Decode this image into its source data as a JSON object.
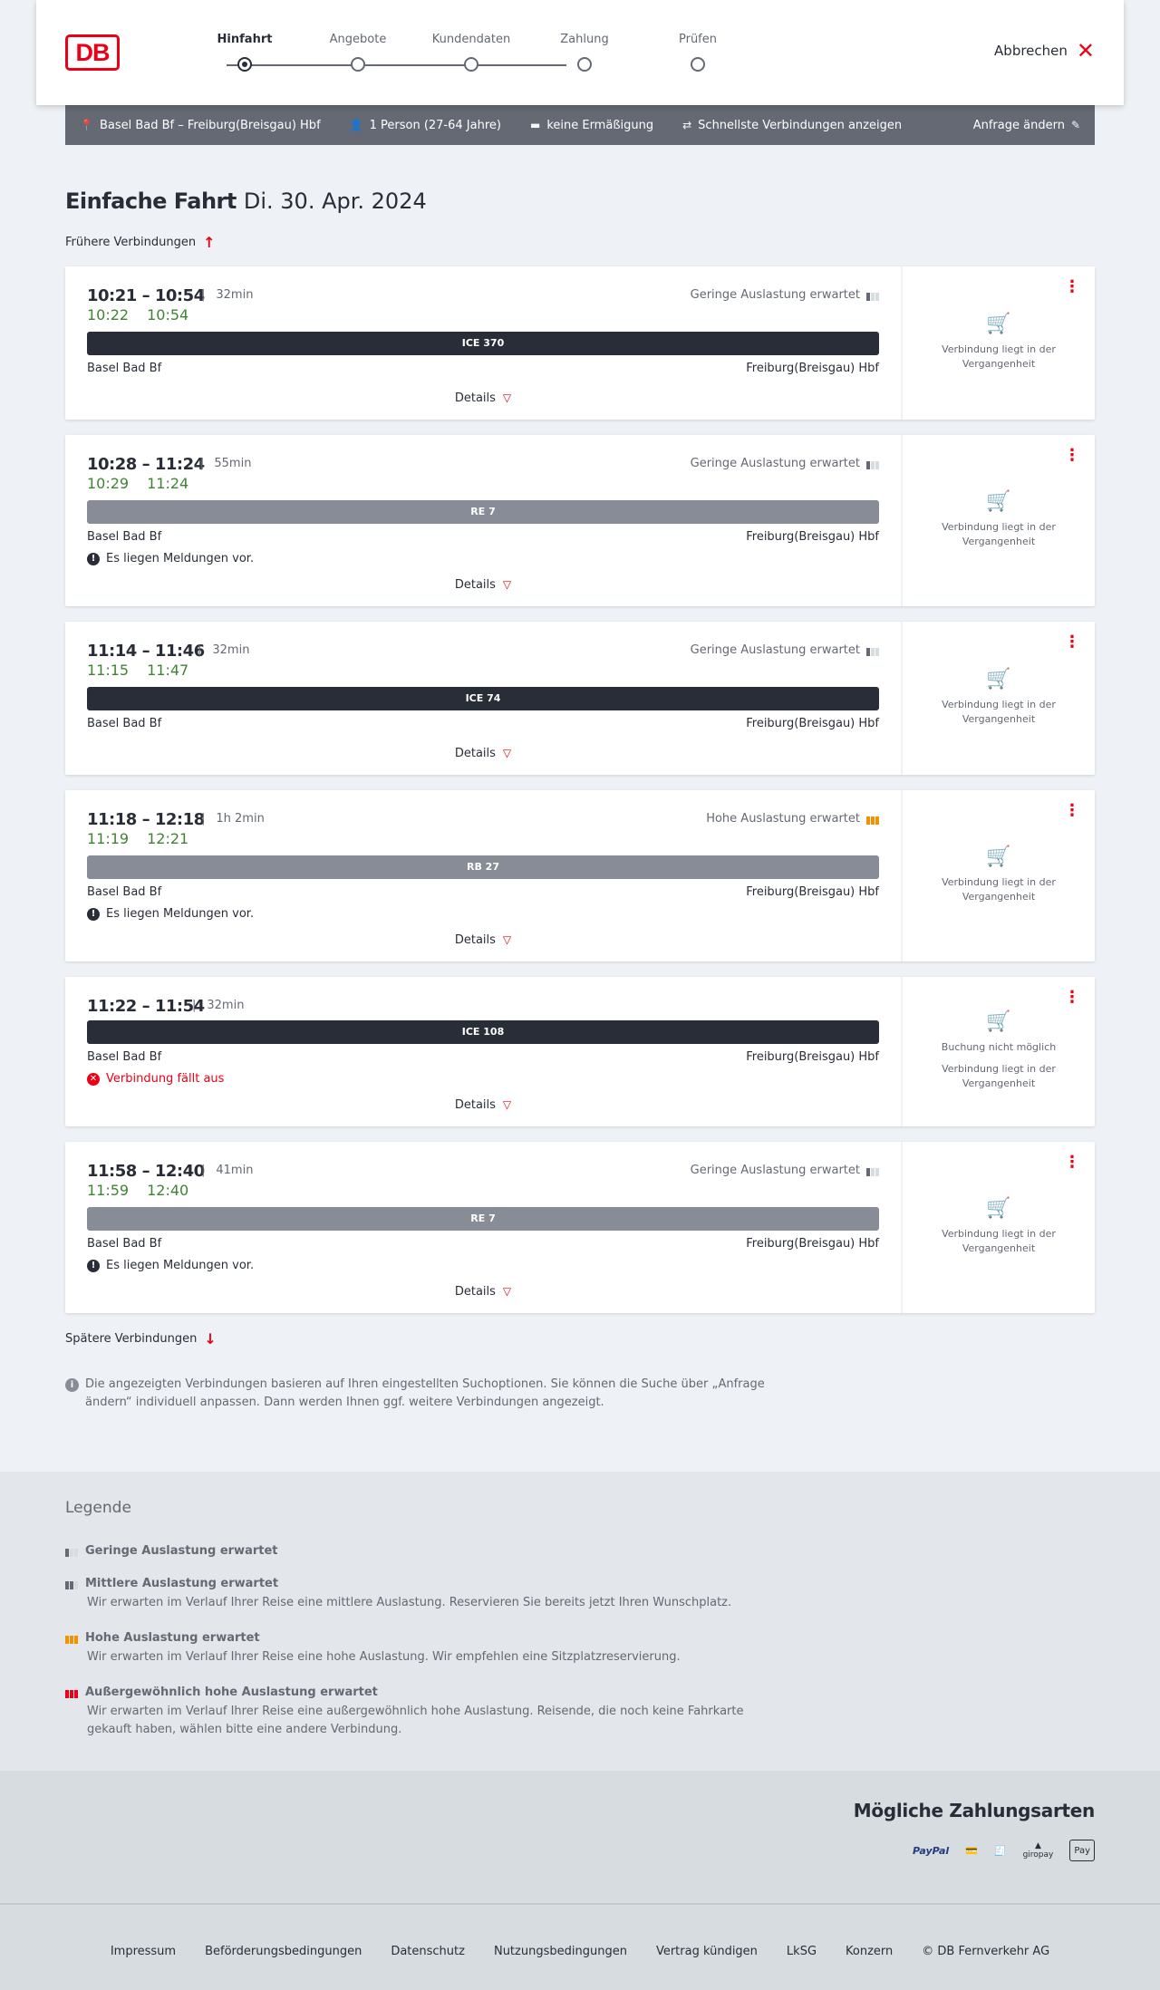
{
  "header": {
    "logo": "DB",
    "steps": [
      "Hinfahrt",
      "Angebote",
      "Kundendaten",
      "Zahlung",
      "Prüfen"
    ],
    "cancel_label": "Abbrechen"
  },
  "query": {
    "route": "Basel Bad Bf – Freiburg(Breisgau) Hbf",
    "persons": "1 Person (27-64 Jahre)",
    "discount": "keine Ermäßigung",
    "fastest": "Schnellste Verbindungen anzeigen",
    "change": "Anfrage ändern"
  },
  "title": {
    "main": "Einfache Fahrt",
    "date": "Di. 30. Apr. 2024"
  },
  "earlier_label": "Frühere Verbindungen",
  "later_label": "Spätere Verbindungen",
  "details_label": "Details",
  "side_text": "Verbindung liegt in der Vergangenheit",
  "booking_not_possible": "Buchung nicht möglich",
  "connections": [
    {
      "times": "10:21 – 10:54",
      "duration": "32min",
      "rt_dep": "10:22",
      "rt_arr": "10:54",
      "occupancy": "Geringe Auslastung erwartet",
      "train": "ICE 370",
      "from": "Basel Bad Bf",
      "to": "Freiburg(Breisgau) Hbf"
    },
    {
      "times": "10:28 – 11:24",
      "duration": "55min",
      "rt_dep": "10:29",
      "rt_arr": "11:24",
      "occupancy": "Geringe Auslastung erwartet",
      "train": "RE 7",
      "from": "Basel Bad Bf",
      "to": "Freiburg(Breisgau) Hbf",
      "message": "Es liegen Meldungen vor."
    },
    {
      "times": "11:14 – 11:46",
      "duration": "32min",
      "rt_dep": "11:15",
      "rt_arr": "11:47",
      "occupancy": "Geringe Auslastung erwartet",
      "train": "ICE 74",
      "from": "Basel Bad Bf",
      "to": "Freiburg(Breisgau) Hbf"
    },
    {
      "times": "11:18 – 12:18",
      "duration": "1h 2min",
      "rt_dep": "11:19",
      "rt_arr": "12:21",
      "occupancy": "Hohe Auslastung erwartet",
      "train": "RB 27",
      "from": "Basel Bad Bf",
      "to": "Freiburg(Breisgau) Hbf",
      "message": "Es liegen Meldungen vor."
    },
    {
      "times": "11:22 – 11:54",
      "duration": "32min",
      "train": "ICE 108",
      "from": "Basel Bad Bf",
      "to": "Freiburg(Breisgau) Hbf",
      "message": "Verbindung fällt aus"
    },
    {
      "times": "11:58 – 12:40",
      "duration": "41min",
      "rt_dep": "11:59",
      "rt_arr": "12:40",
      "occupancy": "Geringe Auslastung erwartet",
      "train": "RE 7",
      "from": "Basel Bad Bf",
      "to": "Freiburg(Breisgau) Hbf",
      "message": "Es liegen Meldungen vor."
    }
  ],
  "info_text": "Die angezeigten Verbindungen basieren auf Ihren eingestellten Suchoptionen. Sie können die Suche über „Anfrage ändern“ individuell anpassen. Dann werden Ihnen ggf. weitere Verbindungen angezeigt.",
  "legend": {
    "title": "Legende",
    "items": [
      {
        "title": "Geringe Auslastung erwartet",
        "desc": ""
      },
      {
        "title": "Mittlere Auslastung erwartet",
        "desc": "Wir erwarten im Verlauf Ihrer Reise eine mittlere Auslastung. Reservieren Sie bereits jetzt Ihren Wunschplatz."
      },
      {
        "title": "Hohe Auslastung erwartet",
        "desc": "Wir erwarten im Verlauf Ihrer Reise eine hohe Auslastung. Wir empfehlen eine Sitzplatzreservierung."
      },
      {
        "title": "Außergewöhnlich hohe Auslastung erwartet",
        "desc": "Wir erwarten im Verlauf Ihrer Reise eine außergewöhnlich hohe Auslastung. Reisende, die noch keine Fahrkarte gekauft haben, wählen bitte eine andere Verbindung."
      }
    ]
  },
  "payment": {
    "title": "Mögliche Zahlungsarten",
    "paypal": "PayPal",
    "giropay": "giropay",
    "applepay": "Pay"
  },
  "footer": [
    "Impressum",
    "Beförderungsbedingungen",
    "Datenschutz",
    "Nutzungsbedingungen",
    "Vertrag kündigen",
    "LkSG",
    "Konzern",
    "© DB Fernverkehr AG"
  ],
  "colors": {
    "accent": "#ec0016",
    "realtime": "#408335",
    "high_occupancy": "#f39200",
    "querybar": "#646973"
  }
}
